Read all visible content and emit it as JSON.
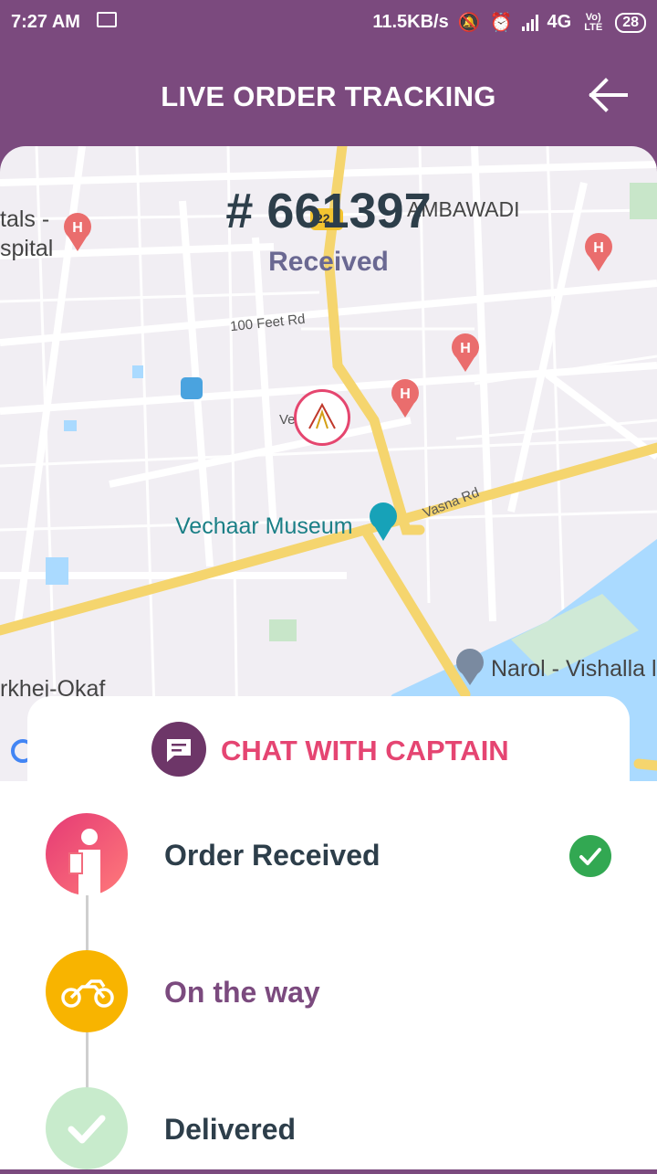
{
  "status_bar": {
    "time": "7:27 AM",
    "speed": "11.5KB/s",
    "network": "4G",
    "volte": "Vo) LTE",
    "battery": "28"
  },
  "header": {
    "title": "LIVE ORDER TRACKING"
  },
  "order": {
    "number": "# 661397",
    "status": "Received"
  },
  "map": {
    "labels": {
      "museum": "Vechaar Museum",
      "narol": "Narol - Vishalla l",
      "sarkhej": "rkhej-Okaf",
      "hospital_1": "tals -",
      "hospital_2": "spital",
      "ambawadi": "AMBAWADI",
      "road_100ft": "100 Feet Rd",
      "road_vasna": "Vasna Rd",
      "ve": "Ve",
      "highway": "22"
    }
  },
  "chat": {
    "label": "CHAT WITH CAPTAIN"
  },
  "steps": [
    {
      "label": "Order Received",
      "color": "#2d3e4a",
      "done": true
    },
    {
      "label": "On the way",
      "color": "#7b4a7e",
      "done": false
    },
    {
      "label": "Delivered",
      "color": "#2d3e4a",
      "done": false
    }
  ],
  "colors": {
    "primary": "#7b4a7e",
    "accent": "#e54572",
    "success": "#32a852",
    "map_road": "#f5d56e"
  }
}
